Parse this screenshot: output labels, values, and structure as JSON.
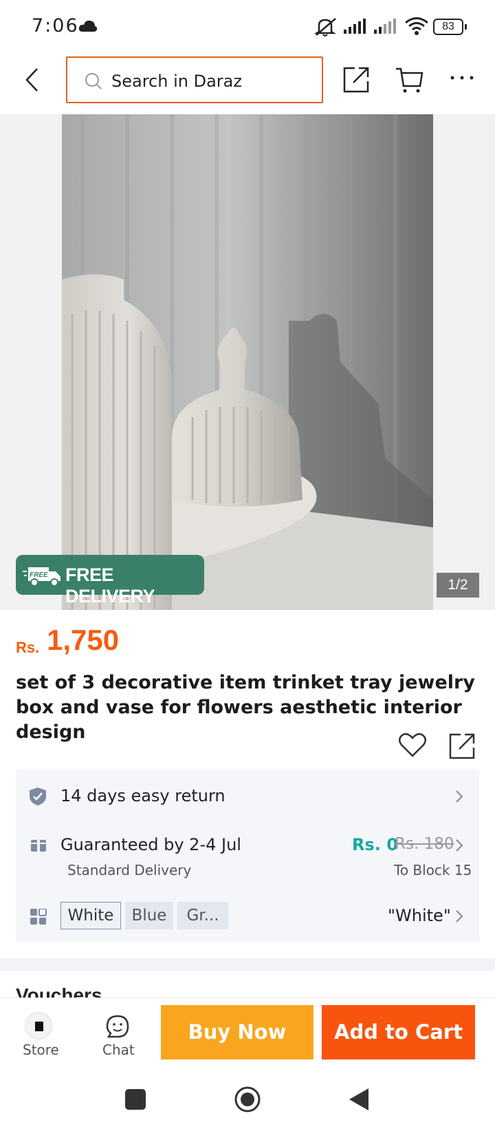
{
  "status_bar": {
    "time": "7:06",
    "battery": "83"
  },
  "top_bar": {
    "search_placeholder": "Search in Daraz"
  },
  "gallery": {
    "free_delivery_tag": "FREE",
    "free_delivery_label": "FREE DELIVERY",
    "counter": "1/2"
  },
  "product": {
    "currency": "Rs.",
    "price": "1,750",
    "title": "set of 3 decorative item trinket tray jewelry box and vase for flowers aesthetic interior design"
  },
  "info": {
    "returns": "14 days easy return",
    "delivery_guarantee": "Guaranteed by 2-4 Jul",
    "delivery_type": "Standard Delivery",
    "delivery_fee": "Rs. 0",
    "delivery_fee_original": "Rs. 180",
    "delivery_location": "To Block 15",
    "variants": [
      "White",
      "Blue",
      "Gr..."
    ],
    "selected_variant": "\"White\""
  },
  "vouchers_label": "Vouchers",
  "bottom_bar": {
    "store_label": "Store",
    "chat_label": "Chat",
    "buy_now": "Buy Now",
    "add_to_cart": "Add to Cart"
  },
  "colors": {
    "accent": "#f25d11",
    "search_border": "#e4631f",
    "buy_now": "#f9a51f",
    "add_to_cart": "#f8540e",
    "free_delivery": "#3a8068",
    "free_fee": "#1aa9a0"
  }
}
